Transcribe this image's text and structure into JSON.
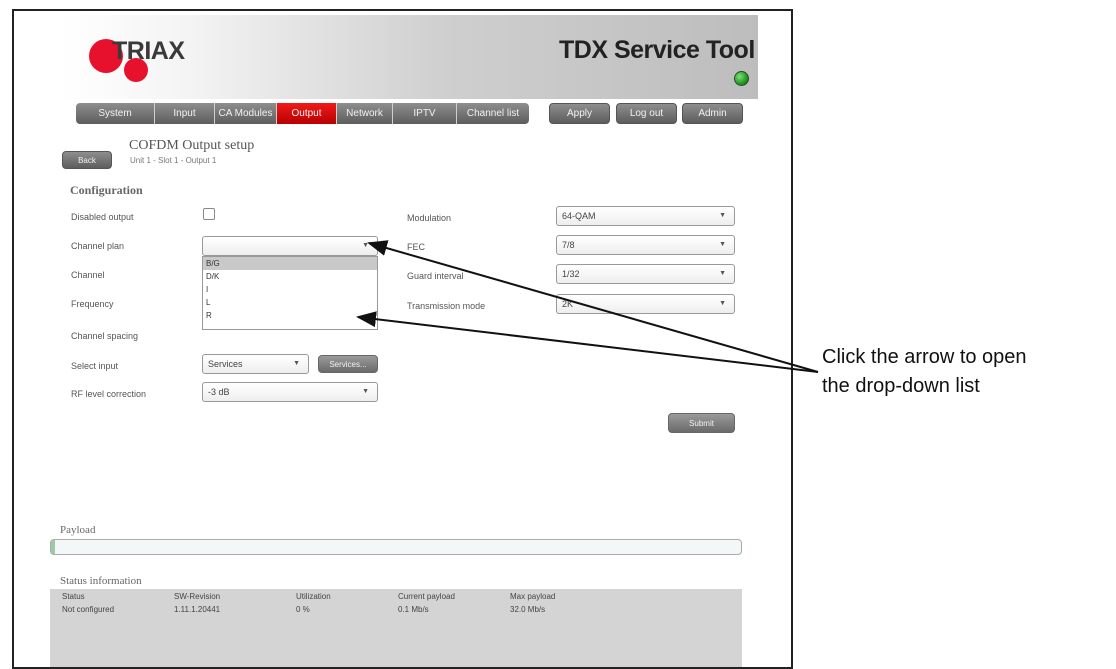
{
  "header": {
    "logo_text": "TRIAX",
    "app_title": "TDX Service Tool"
  },
  "nav": {
    "tabs": [
      {
        "label": "System"
      },
      {
        "label": "Input"
      },
      {
        "label": "CA Modules"
      },
      {
        "label": "Output",
        "active": true
      },
      {
        "label": "Network"
      },
      {
        "label": "IPTV"
      },
      {
        "label": "Channel list"
      }
    ],
    "apply_label": "Apply",
    "logout_label": "Log out",
    "admin_label": "Admin"
  },
  "page": {
    "back_label": "Back",
    "title": "COFDM Output setup",
    "breadcrumb": "Unit 1 - Slot 1 - Output 1"
  },
  "config": {
    "section_title": "Configuration",
    "disabled_output_label": "Disabled output",
    "disabled_output_checked": false,
    "channel_plan_label": "Channel plan",
    "channel_plan_value": "",
    "channel_plan_options": [
      "B/G",
      "D/K",
      "I",
      "L",
      "R"
    ],
    "channel_plan_highlighted": "B/G",
    "channel_label": "Channel",
    "frequency_label": "Frequency",
    "channel_spacing_label": "Channel spacing",
    "select_input_label": "Select input",
    "select_input_value": "Services",
    "services_button_label": "Services...",
    "rf_level_label": "RF level correction",
    "rf_level_value": "-3 dB",
    "modulation_label": "Modulation",
    "modulation_value": "64-QAM",
    "fec_label": "FEC",
    "fec_value": "7/8",
    "guard_interval_label": "Guard interval",
    "guard_interval_value": "1/32",
    "transmission_mode_label": "Transmission mode",
    "transmission_mode_value": "2K",
    "submit_label": "Submit"
  },
  "payload": {
    "title": "Payload"
  },
  "status": {
    "title": "Status information",
    "headers": [
      "Status",
      "SW-Revision",
      "Utilization",
      "Current payload",
      "Max payload"
    ],
    "values": [
      "Not configured",
      "1.11.1.20441",
      "0 %",
      "0.1 Mb/s",
      "32.0 Mb/s"
    ]
  },
  "callout": {
    "line1": "Click the arrow to open",
    "line2": "the drop-down list"
  },
  "colors": {
    "accent_red": "#e8112d",
    "active_tab": "#d00000",
    "status_led": "#1f9a1f"
  }
}
